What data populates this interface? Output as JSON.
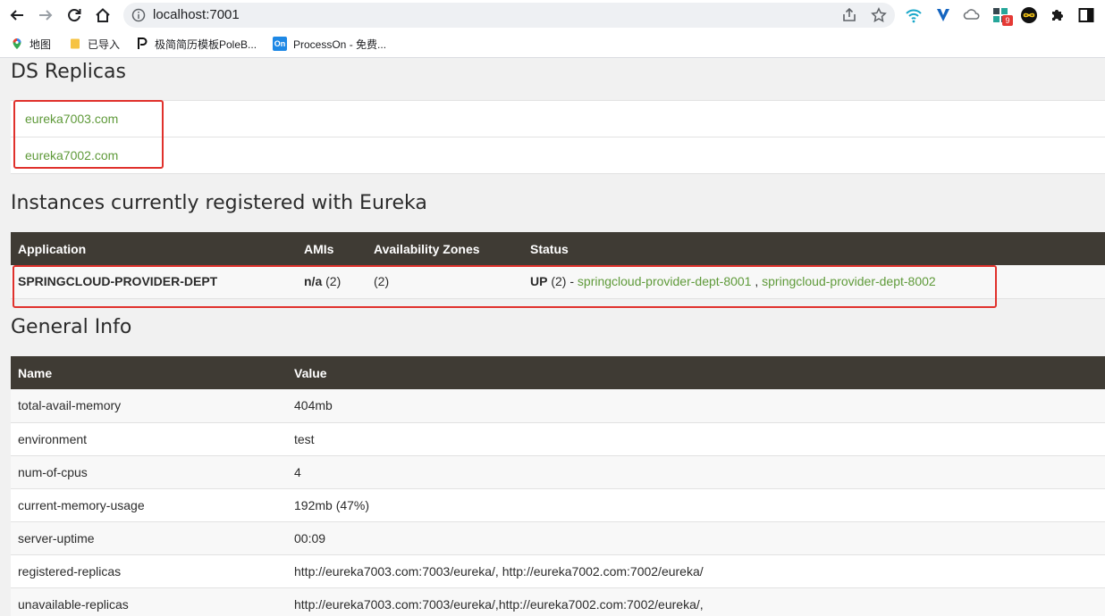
{
  "browser": {
    "url": "localhost:7001",
    "extension_badge": "9",
    "bookmarks": [
      {
        "label": "地图",
        "icon": "maps-pin-icon"
      },
      {
        "label": "已导入",
        "icon": "folder-icon"
      },
      {
        "label": "极简简历模板PoleB...",
        "icon": "poleb-icon"
      },
      {
        "label": "ProcessOn - 免费...",
        "icon": "processon-icon",
        "icon_text": "On"
      }
    ]
  },
  "ds_replicas": {
    "title": "DS Replicas",
    "items": [
      "eureka7003.com",
      "eureka7002.com"
    ]
  },
  "instances": {
    "title": "Instances currently registered with Eureka",
    "headers": [
      "Application",
      "AMIs",
      "Availability Zones",
      "Status"
    ],
    "rows": [
      {
        "application": "SPRINGCLOUD-PROVIDER-DEPT",
        "amis_bold": "n/a",
        "amis_count": " (2)",
        "zones": "(2)",
        "status_bold": "UP",
        "status_count": " (2) - ",
        "link1": "springcloud-provider-dept-8001",
        "separator": " , ",
        "link2": "springcloud-provider-dept-8002"
      }
    ]
  },
  "general_info": {
    "title": "General Info",
    "headers": [
      "Name",
      "Value"
    ],
    "rows": [
      {
        "name": "total-avail-memory",
        "value": "404mb"
      },
      {
        "name": "environment",
        "value": "test"
      },
      {
        "name": "num-of-cpus",
        "value": "4"
      },
      {
        "name": "current-memory-usage",
        "value": "192mb (47%)"
      },
      {
        "name": "server-uptime",
        "value": "00:09"
      },
      {
        "name": "registered-replicas",
        "value": "http://eureka7003.com:7003/eureka/, http://eureka7002.com:7002/eureka/"
      },
      {
        "name": "unavailable-replicas",
        "value": "http://eureka7003.com:7003/eureka/,http://eureka7002.com:7002/eureka/,"
      }
    ]
  },
  "colors": {
    "header_bg": "#3f3b34",
    "link": "#5f9a3a",
    "highlight_box": "#e0312c"
  }
}
